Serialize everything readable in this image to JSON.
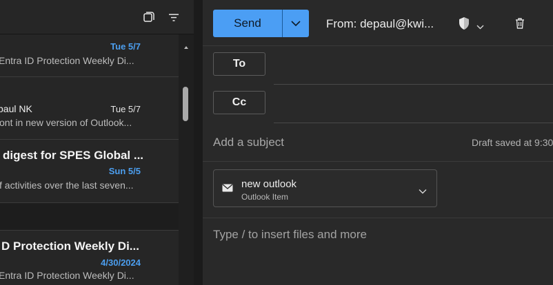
{
  "message_list": {
    "toolbar_icons": [
      "select-messages-icon",
      "filter-icon"
    ],
    "messages": [
      {
        "sender": "",
        "date": "Tue 5/7",
        "date_unread": true,
        "preview": "Entra ID Protection Weekly Di..."
      },
      {
        "sender": "paul NK",
        "date": "Tue 5/7",
        "date_unread": false,
        "preview": "ont in new version of Outlook..."
      },
      {
        "subject": "digest for SPES Global ...",
        "date": "Sun 5/5",
        "date_unread": true,
        "preview": "f activities over the last seven..."
      },
      {
        "subject": "D Protection Weekly Di...",
        "date": "4/30/2024",
        "date_unread": true,
        "preview": "Entra ID Protection Weekly Di..."
      }
    ]
  },
  "compose": {
    "send_label": "Send",
    "from_label": "From: depaul@kwi...",
    "to_label": "To",
    "cc_label": "Cc",
    "subject_placeholder": "Add a subject",
    "draft_status": "Draft saved at 9:30",
    "attachment": {
      "name": "new outlook",
      "type": "Outlook Item"
    },
    "body_placeholder": "Type / to insert files and more"
  },
  "colors": {
    "accent": "#4b9ef4",
    "unread_date": "#4c9ff0"
  }
}
